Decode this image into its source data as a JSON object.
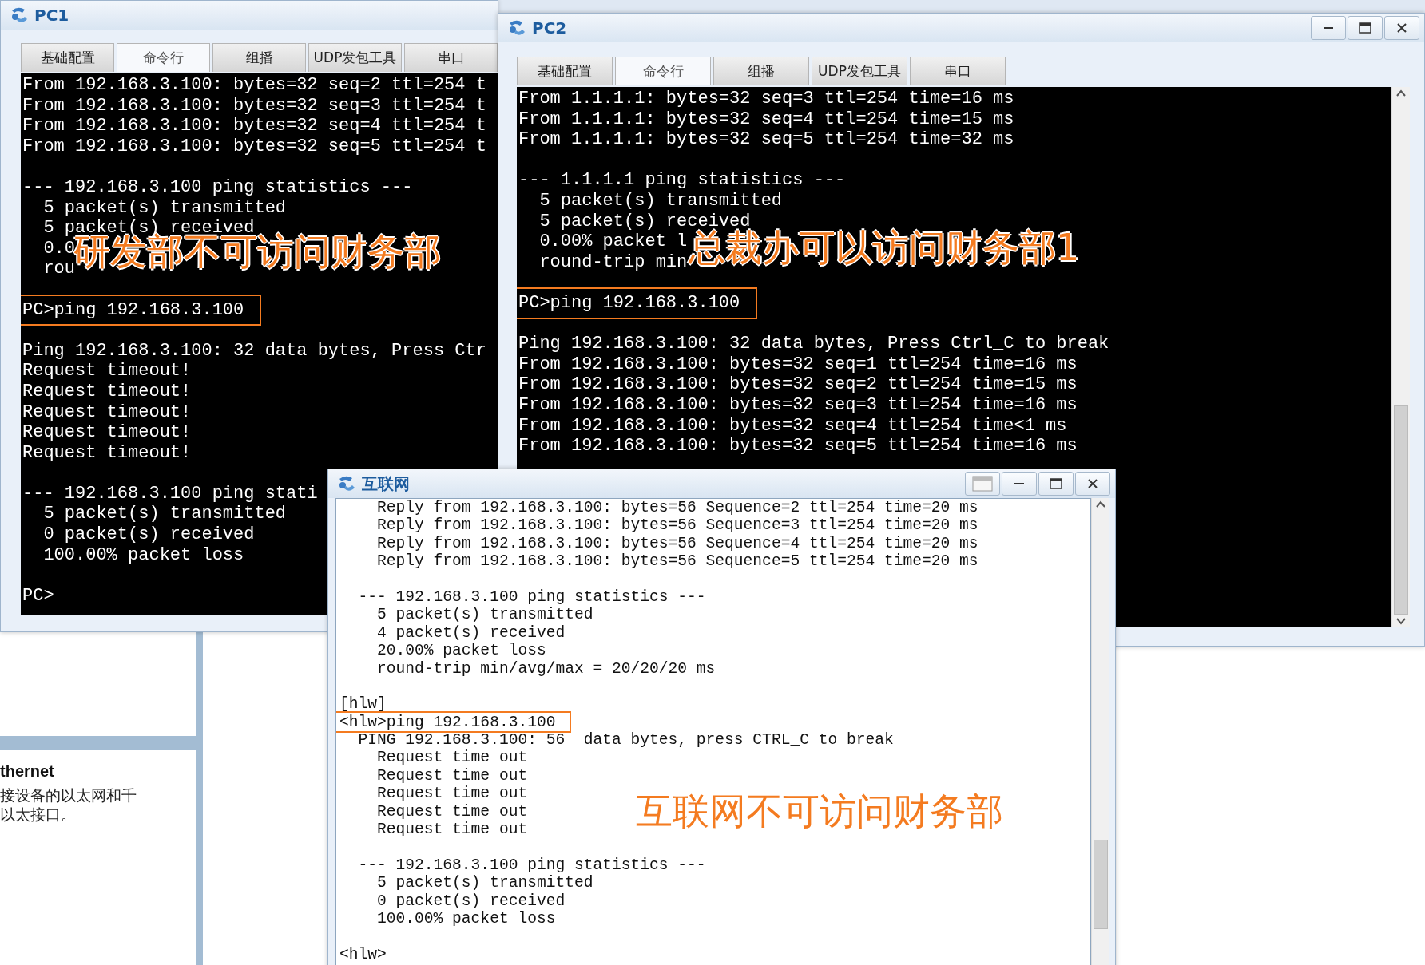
{
  "side_panel": {
    "heading": "thernet",
    "description_lines": [
      "接设备的以太网和千",
      "以太接口。"
    ]
  },
  "windows": [
    {
      "kind": "pc",
      "title": "PC1",
      "scrollbar": false,
      "tabs": [
        {
          "label": "基础配置",
          "selected": false
        },
        {
          "label": "命令行",
          "selected": true
        },
        {
          "label": "组播",
          "selected": false
        },
        {
          "label": "UDP发包工具",
          "selected": false
        },
        {
          "label": "串口",
          "selected": false
        }
      ],
      "annotation": "研发部不可访问财务部",
      "lines": [
        {
          "kind": "output",
          "text": "From 192.168.3.100: bytes=32 seq=2 ttl=254 t"
        },
        {
          "kind": "output",
          "text": "From 192.168.3.100: bytes=32 seq=3 ttl=254 t"
        },
        {
          "kind": "output",
          "text": "From 192.168.3.100: bytes=32 seq=4 ttl=254 t"
        },
        {
          "kind": "output",
          "text": "From 192.168.3.100: bytes=32 seq=5 ttl=254 t"
        },
        {
          "kind": "blank"
        },
        {
          "kind": "output",
          "text": "--- 192.168.3.100 ping statistics ---"
        },
        {
          "kind": "output",
          "text": "  5 packet(s) transmitted"
        },
        {
          "kind": "output",
          "text": "  5 packet(s) received"
        },
        {
          "kind": "output",
          "text": "  0.0"
        },
        {
          "kind": "output",
          "text": "  rou"
        },
        {
          "kind": "blank"
        },
        {
          "kind": "command",
          "text": "PC>ping 192.168.3.100"
        },
        {
          "kind": "blank"
        },
        {
          "kind": "output",
          "text": "Ping 192.168.3.100: 32 data bytes, Press Ctr"
        },
        {
          "kind": "output",
          "text": "Request timeout!"
        },
        {
          "kind": "output",
          "text": "Request timeout!"
        },
        {
          "kind": "output",
          "text": "Request timeout!"
        },
        {
          "kind": "output",
          "text": "Request timeout!"
        },
        {
          "kind": "output",
          "text": "Request timeout!"
        },
        {
          "kind": "blank"
        },
        {
          "kind": "output",
          "text": "--- 192.168.3.100 ping stati"
        },
        {
          "kind": "output",
          "text": "  5 packet(s) transmitted"
        },
        {
          "kind": "output",
          "text": "  0 packet(s) received"
        },
        {
          "kind": "output",
          "text": "  100.00% packet loss"
        },
        {
          "kind": "blank"
        },
        {
          "kind": "output",
          "text": "PC>"
        }
      ]
    },
    {
      "kind": "pc",
      "title": "PC2",
      "buttons": [
        {
          "kind": "minimize"
        },
        {
          "kind": "maximize"
        },
        {
          "kind": "close"
        }
      ],
      "scrollbar": true,
      "tabs": [
        {
          "label": "基础配置",
          "selected": false
        },
        {
          "label": "命令行",
          "selected": true
        },
        {
          "label": "组播",
          "selected": false
        },
        {
          "label": "UDP发包工具",
          "selected": false
        },
        {
          "label": "串口",
          "selected": false
        }
      ],
      "annotation": "总裁办可以访问财务部1",
      "lines": [
        {
          "kind": "output",
          "text": "From 1.1.1.1: bytes=32 seq=3 ttl=254 time=16 ms"
        },
        {
          "kind": "output",
          "text": "From 1.1.1.1: bytes=32 seq=4 ttl=254 time=15 ms"
        },
        {
          "kind": "output",
          "text": "From 1.1.1.1: bytes=32 seq=5 ttl=254 time=32 ms"
        },
        {
          "kind": "blank"
        },
        {
          "kind": "output",
          "text": "--- 1.1.1.1 ping statistics ---"
        },
        {
          "kind": "output",
          "text": "  5 packet(s) transmitted"
        },
        {
          "kind": "output",
          "text": "  5 packet(s) received"
        },
        {
          "kind": "output",
          "text": "  0.00% packet l"
        },
        {
          "kind": "output",
          "text": "  round-trip min"
        },
        {
          "kind": "blank"
        },
        {
          "kind": "command",
          "text": "PC>ping 192.168.3.100"
        },
        {
          "kind": "blank"
        },
        {
          "kind": "output",
          "text": "Ping 192.168.3.100: 32 data bytes, Press Ctrl_C to break"
        },
        {
          "kind": "output",
          "text": "From 192.168.3.100: bytes=32 seq=1 ttl=254 time=16 ms"
        },
        {
          "kind": "output",
          "text": "From 192.168.3.100: bytes=32 seq=2 ttl=254 time=15 ms"
        },
        {
          "kind": "output",
          "text": "From 192.168.3.100: bytes=32 seq=3 ttl=254 time=16 ms"
        },
        {
          "kind": "output",
          "text": "From 192.168.3.100: bytes=32 seq=4 ttl=254 time<1 ms"
        },
        {
          "kind": "output",
          "text": "From 192.168.3.100: bytes=32 seq=5 ttl=254 time=16 ms"
        }
      ]
    },
    {
      "kind": "device",
      "title": "互联网",
      "buttons": [
        {
          "kind": "panel"
        },
        {
          "kind": "minimize"
        },
        {
          "kind": "maximize"
        },
        {
          "kind": "close"
        }
      ],
      "scrollbar": true,
      "annotation": "互联网不可访问财务部",
      "lines": [
        {
          "kind": "output",
          "text": "    Reply from 192.168.3.100: bytes=56 Sequence=2 ttl=254 time=20 ms"
        },
        {
          "kind": "output",
          "text": "    Reply from 192.168.3.100: bytes=56 Sequence=3 ttl=254 time=20 ms"
        },
        {
          "kind": "output",
          "text": "    Reply from 192.168.3.100: bytes=56 Sequence=4 ttl=254 time=20 ms"
        },
        {
          "kind": "output",
          "text": "    Reply from 192.168.3.100: bytes=56 Sequence=5 ttl=254 time=20 ms"
        },
        {
          "kind": "blank"
        },
        {
          "kind": "output",
          "text": "  --- 192.168.3.100 ping statistics ---"
        },
        {
          "kind": "output",
          "text": "    5 packet(s) transmitted"
        },
        {
          "kind": "output",
          "text": "    4 packet(s) received"
        },
        {
          "kind": "output",
          "text": "    20.00% packet loss"
        },
        {
          "kind": "output",
          "text": "    round-trip min/avg/max = 20/20/20 ms"
        },
        {
          "kind": "blank"
        },
        {
          "kind": "output",
          "text": "[hlw]"
        },
        {
          "kind": "command",
          "text": "<hlw>ping 192.168.3.100"
        },
        {
          "kind": "output",
          "text": "  PING 192.168.3.100: 56  data bytes, press CTRL_C to break"
        },
        {
          "kind": "output",
          "text": "    Request time out"
        },
        {
          "kind": "output",
          "text": "    Request time out"
        },
        {
          "kind": "output",
          "text": "    Request time out"
        },
        {
          "kind": "output",
          "text": "    Request time out"
        },
        {
          "kind": "output",
          "text": "    Request time out"
        },
        {
          "kind": "blank"
        },
        {
          "kind": "output",
          "text": "  --- 192.168.3.100 ping statistics ---"
        },
        {
          "kind": "output",
          "text": "    5 packet(s) transmitted"
        },
        {
          "kind": "output",
          "text": "    0 packet(s) received"
        },
        {
          "kind": "output",
          "text": "    100.00% packet loss"
        },
        {
          "kind": "blank"
        },
        {
          "kind": "output",
          "text": "<hlw>"
        }
      ]
    }
  ]
}
